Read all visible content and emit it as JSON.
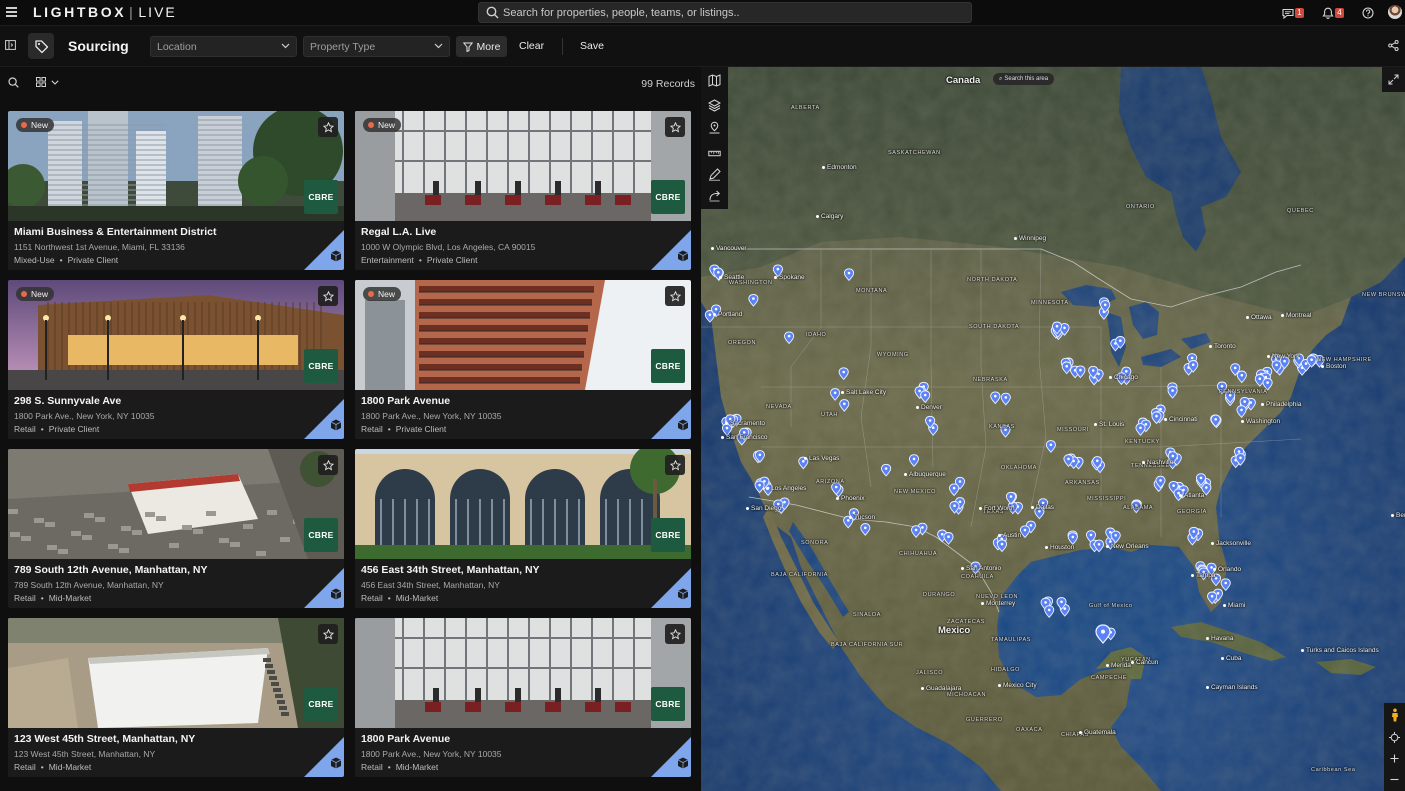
{
  "app": {
    "logo_left": "LIGHTBOX",
    "logo_sep": "|",
    "logo_right": "LIVE",
    "search_placeholder": "Search for properties, people, teams, or listings..",
    "messages_count": "1",
    "notifications_count": "4"
  },
  "toolbar": {
    "title": "Sourcing",
    "location_label": "Location",
    "property_type_label": "Property Type",
    "more_label": "More",
    "clear_label": "Clear",
    "save_label": "Save"
  },
  "list": {
    "records_label": "99 Records",
    "new_label": "New",
    "broker_label": "CBRE",
    "cards": [
      {
        "title": "Miami Business & Entertainment District",
        "address": "1151 Northwest 1st Avenue, Miami, FL 33136",
        "type": "Mixed-Use",
        "client": "Private Client",
        "is_new": true,
        "image": "towers"
      },
      {
        "title": "Regal L.A. Live",
        "address": "1000 W Olympic Blvd, Los Angeles, CA 90015",
        "type": "Entertainment",
        "client": "Private Client",
        "is_new": true,
        "image": "atrium"
      },
      {
        "title": "298 S. Sunnyvale Ave",
        "address": "1800 Park Ave., New York, NY 10035",
        "type": "Retail",
        "client": "Private Client",
        "is_new": true,
        "image": "woodbuilding"
      },
      {
        "title": "1800 Park Avenue",
        "address": "1800 Park Ave., New York, NY 10035",
        "type": "Retail",
        "client": "Private Client",
        "is_new": true,
        "image": "balconies"
      },
      {
        "title": "789 South 12th Avenue, Manhattan, NY",
        "address": "789 South 12th Avenue, Manhattan, NY",
        "type": "Retail",
        "client": "Mid-Market",
        "is_new": false,
        "image": "aerial"
      },
      {
        "title": "456 East 34th Street, Manhattan, NY",
        "address": "456 East 34th Street, Manhattan, NY",
        "type": "Retail",
        "client": "Mid-Market",
        "is_new": false,
        "image": "arches"
      },
      {
        "title": "123 West 45th Street, Manhattan, NY",
        "address": "123 West 45th Street, Manhattan, NY",
        "type": "Retail",
        "client": "Mid-Market",
        "is_new": false,
        "image": "warehouse"
      },
      {
        "title": "1800 Park Avenue",
        "address": "1800 Park Ave., New York, NY 10035",
        "type": "Retail",
        "client": "Mid-Market",
        "is_new": false,
        "image": "atrium"
      }
    ]
  },
  "map": {
    "search_area_label": "Search this area",
    "countries": [
      "Canada",
      "Mexico"
    ],
    "states": [
      "ALBERTA",
      "SASKATCHEWAN",
      "ONTARIO",
      "QUEBEC",
      "WASHINGTON",
      "MONTANA",
      "NORTH DAKOTA",
      "MINNESOTA",
      "OREGON",
      "IDAHO",
      "WYOMING",
      "SOUTH DAKOTA",
      "NEBRASKA",
      "NEVADA",
      "UTAH",
      "KANSAS",
      "MISSOURI",
      "KENTUCKY",
      "ARIZONA",
      "NEW MEXICO",
      "OKLAHOMA",
      "ARKANSAS",
      "TENNESSEE",
      "MISSISSIPPI",
      "ALABAMA",
      "TEXAS",
      "CHIHUAHUA",
      "COAHUILA",
      "SONORA",
      "DURANGO",
      "ZACATECAS",
      "SINALOA",
      "NUEVO LEON",
      "NEW HAMPSHIRE",
      "PENNSYLVANIA",
      "NEW BRUNSWICK",
      "GEORGIA",
      "BAJA CALIFORNIA",
      "BAJA CALIFORNIA SUR",
      "TAMAULIPAS",
      "JALISCO",
      "MICHOACAN",
      "GUERRERO",
      "OAXACA",
      "CHIAPAS",
      "YUCATAN",
      "CAMPECHE",
      "HIDALGO"
    ],
    "cities": [
      "Edmonton",
      "Calgary",
      "Winnipeg",
      "Vancouver",
      "Seattle",
      "Portland",
      "Spokane",
      "Salt Lake City",
      "Sacramento",
      "San Francisco",
      "Las Vegas",
      "Los Angeles",
      "San Diego",
      "Phoenix",
      "Tucson",
      "Albuquerque",
      "Denver",
      "Dallas",
      "Fort Worth",
      "Austin",
      "Houston",
      "San Antonio",
      "Monterrey",
      "Chicago",
      "St. Louis",
      "Cincinnati",
      "Nashville",
      "Atlanta",
      "Jacksonville",
      "Orlando",
      "Tampa",
      "Miami",
      "New Orleans",
      "Toronto",
      "Ottawa",
      "Montreal",
      "New York",
      "Philadelphia",
      "Washington",
      "Boston",
      "Havana",
      "Merida",
      "Mexico City",
      "Guadalajara",
      "Guatemala",
      "Cancun"
    ],
    "extra_labels": [
      "Gulf of Mexico",
      "Cuba",
      "Turks and Caicos Islands",
      "Cayman Islands",
      "Bermuda",
      "Caribbean Sea"
    ],
    "pin_color": "#5b83f5"
  },
  "colors": {
    "accent_new": "#e96a4a",
    "badge": "#d2473b",
    "cbre_green": "#1e5a3f",
    "corner_blue": "#7fa6ea"
  }
}
